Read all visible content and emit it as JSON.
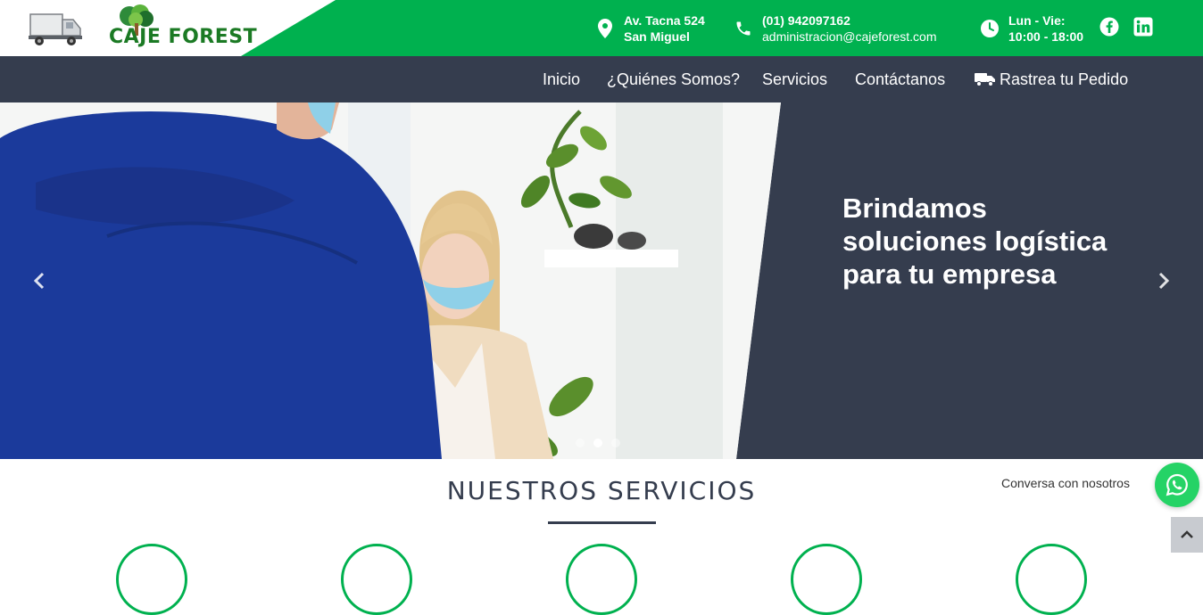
{
  "brand": {
    "logo_text": "CAJE FOREST",
    "primary_color": "#00b14f",
    "dark_color": "#353d4e"
  },
  "topbar": {
    "address": {
      "icon": "map-marker-icon",
      "line1": "Av. Tacna 524",
      "line2": "San Miguel"
    },
    "phone": {
      "icon": "phone-icon",
      "line1": "(01) 942097162",
      "line2": "administracion@cajeforest.com"
    },
    "hours": {
      "icon": "clock-icon",
      "line1": "Lun - Vie:",
      "line2": "10:00 - 18:00"
    },
    "social": [
      {
        "icon": "facebook-icon"
      },
      {
        "icon": "linkedin-icon"
      }
    ]
  },
  "nav": {
    "items": [
      {
        "label": "Inicio"
      },
      {
        "label": "¿Quiénes Somos?"
      },
      {
        "label": "Servicios"
      },
      {
        "label": "Contáctanos"
      },
      {
        "label": "Rastrea tu Pedido",
        "icon": "truck-icon"
      }
    ]
  },
  "hero": {
    "title": "Brindamos soluciones logística para tu empresa",
    "prev_icon": "chevron-left-icon",
    "next_icon": "chevron-right-icon",
    "slide_count": 3,
    "active_slide": 2
  },
  "services": {
    "title": "NUESTROS SERVICIOS"
  },
  "whatsapp": {
    "label": "Conversa con nosotros",
    "icon": "whatsapp-icon"
  },
  "scroll_top": {
    "icon": "chevron-up-icon"
  }
}
